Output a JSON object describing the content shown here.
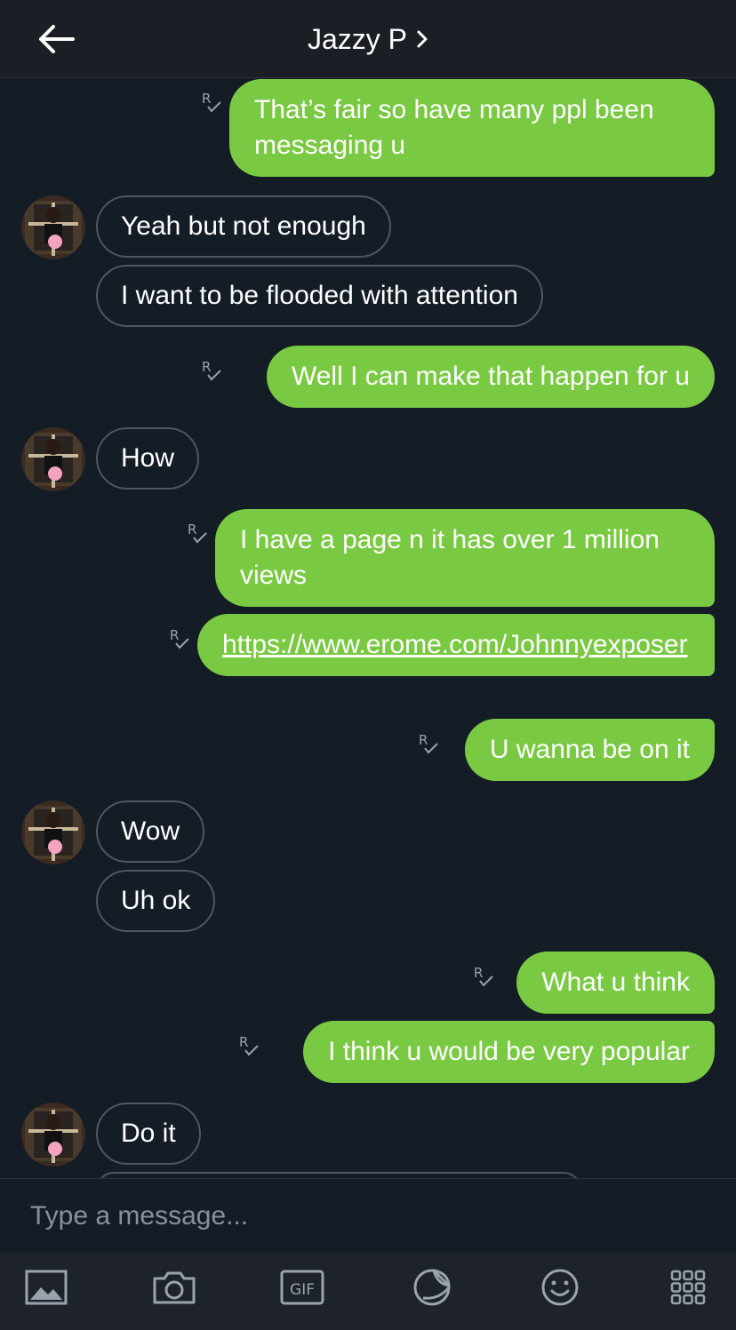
{
  "header": {
    "contact_name": "Jazzy P",
    "back_icon": "arrow-left-icon",
    "chevron_icon": "chevron-right-icon"
  },
  "messages": [
    {
      "from": "me",
      "text": "That’s fair so have many ppl been messaging u"
    },
    {
      "from": "them",
      "text": "Yeah but not enough"
    },
    {
      "from": "them",
      "text": "I want to be flooded with attention"
    },
    {
      "from": "me",
      "text": "Well I can make that happen for u"
    },
    {
      "from": "them",
      "text": "How"
    },
    {
      "from": "me",
      "text": "I have a page n it has over 1 million views"
    },
    {
      "from": "me",
      "text": "https://www.erome.com/Johnnyexposer",
      "is_link": true
    },
    {
      "from": "me",
      "text": "U wanna be on it"
    },
    {
      "from": "them",
      "text": "Wow"
    },
    {
      "from": "them",
      "text": "Uh ok"
    },
    {
      "from": "me",
      "text": "What u think"
    },
    {
      "from": "me",
      "text": "I think u would be very popular"
    },
    {
      "from": "them",
      "text": "Do it"
    }
  ],
  "receipt_glyph": "R",
  "input": {
    "placeholder": "Type a message..."
  },
  "toolbar": {
    "gif_label": "GIF",
    "icons": [
      "image-icon",
      "camera-icon",
      "gif-icon",
      "sticker-icon",
      "emoji-icon",
      "apps-grid-icon"
    ]
  },
  "colors": {
    "background": "#141c26",
    "header": "#1b1f25",
    "outgoing_bubble": "#7ac943",
    "incoming_border": "#4e5661",
    "toolbar": "#1e2329",
    "icon": "#9aa3ad"
  }
}
